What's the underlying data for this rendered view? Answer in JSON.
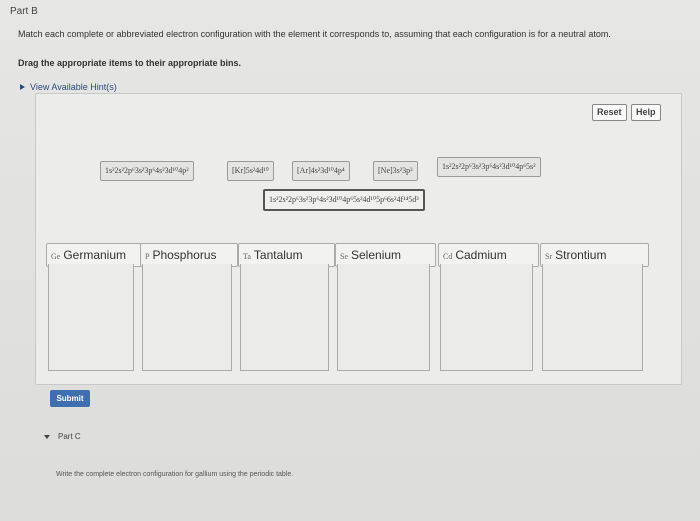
{
  "header": {
    "part_label": "Part B"
  },
  "instructions": {
    "line1": "Match each complete or abbreviated electron configuration with the element it corresponds to, assuming that each configuration is for a neutral atom.",
    "line2": "Drag the appropriate items to their appropriate bins.",
    "hint": "View Available Hint(s)"
  },
  "toolbar": {
    "reset_label": "Reset",
    "help_label": "Help"
  },
  "chips": [
    "1s²2s²2p⁶3s²3p⁶4s²3d¹⁰4p²",
    "[Kr]5s²4d¹⁰",
    "[Ar]4s²3d¹⁰4p⁴",
    "[Ne]3s²3p³",
    "1s²2s²2p⁶3s²3p⁶4s²3d¹⁰4p⁶5s²",
    "1s²2s²2p⁶3s²3p⁶4s²3d¹⁰4p⁶5s²4d¹⁰5p⁶6s²4f¹⁴5d³"
  ],
  "bins": [
    {
      "symbol": "Ge",
      "name": "Germanium"
    },
    {
      "symbol": "P",
      "name": "Phosphorus"
    },
    {
      "symbol": "Ta",
      "name": "Tantalum"
    },
    {
      "symbol": "Se",
      "name": "Selenium"
    },
    {
      "symbol": "Cd",
      "name": "Cadmium"
    },
    {
      "symbol": "Sr",
      "name": "Strontium"
    }
  ],
  "submit_label": "Submit",
  "part_c": {
    "label": "Part C",
    "instruction": "Write the complete electron configuration for gallium using the periodic table."
  }
}
